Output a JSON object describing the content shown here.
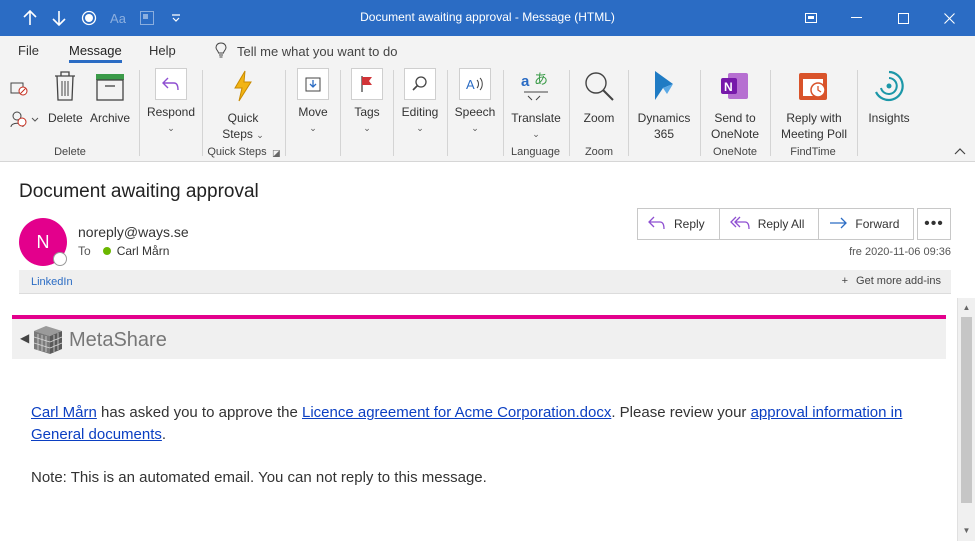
{
  "titlebar": {
    "title": "Document awaiting approval  -  Message (HTML)",
    "bg_color": "#2b6cc4"
  },
  "menu": {
    "tabs": [
      "File",
      "Message",
      "Help"
    ],
    "active_tab": "Message",
    "tell_me": "Tell me what you want to do"
  },
  "ribbon": {
    "delete_label": "Delete",
    "archive_label": "Archive",
    "respond_label": "Respond",
    "quick_steps_label": "Quick",
    "quick_steps_label2": "Steps",
    "move_label": "Move",
    "tags_label": "Tags",
    "editing_label": "Editing",
    "speech_label": "Speech",
    "translate_label": "Translate",
    "zoom_label": "Zoom",
    "dynamics_label": "Dynamics",
    "dynamics_label2": "365",
    "onenote_label": "Send to",
    "onenote_label2": "OneNote",
    "findtime_label": "Reply with",
    "findtime_label2": "Meeting Poll",
    "insights_label": "Insights",
    "groups": {
      "delete": "Delete",
      "quick_steps": "Quick Steps",
      "language": "Language",
      "zoom": "Zoom",
      "onenote": "OneNote",
      "findtime": "FindTime"
    }
  },
  "message": {
    "subject": "Document awaiting approval",
    "avatar_initial": "N",
    "avatar_color": "#e3008c",
    "sender": "noreply@ways.se",
    "to_label": "To",
    "to_name": "Carl Mårn",
    "date": "fre 2020-11-06 09:36",
    "actions": {
      "reply": "Reply",
      "reply_all": "Reply All",
      "forward": "Forward"
    },
    "addin_link": "LinkedIn",
    "get_addins": "Get more add-ins"
  },
  "body": {
    "brand": "MetaShare",
    "brand_color": "#e3008c",
    "link_person": "Carl Mårn",
    "text_1": " has asked you to approve the ",
    "link_doc": "Licence agreement for Acme Corporation.docx",
    "text_2": ". Please review your ",
    "link_approval": "approval information in General documents",
    "text_3": ".",
    "note": "Note: This is an automated email. You can not reply to this message."
  }
}
